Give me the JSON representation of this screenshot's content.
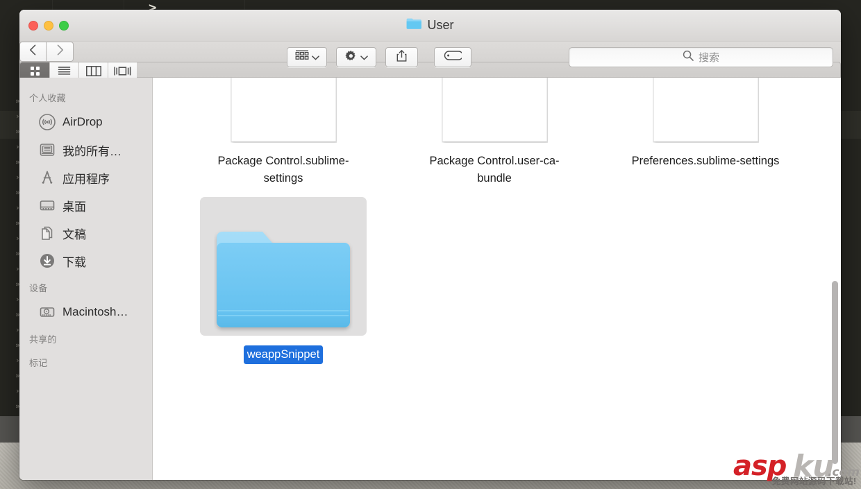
{
  "desktop": {
    "terminal_prompt": ">",
    "terminal_ticks": [
      "»",
      "›",
      "»",
      "›",
      "»",
      "›",
      "»",
      "›",
      "»",
      "›",
      "»",
      "›",
      "»",
      "›",
      "»",
      "›",
      "»",
      "›",
      "»",
      "›",
      "»",
      "›"
    ]
  },
  "window": {
    "title": "User",
    "title_icon": "folder-icon",
    "traffic_lights": [
      {
        "name": "close-button",
        "color": "#fc6058"
      },
      {
        "name": "minimize-button",
        "color": "#fec041"
      },
      {
        "name": "maximize-button",
        "color": "#3dcd47"
      }
    ]
  },
  "toolbar": {
    "back_icon": "chevron-left-icon",
    "forward_icon": "chevron-right-icon",
    "view_modes": [
      {
        "name": "icon-view",
        "icon": "grid-icon",
        "active": true
      },
      {
        "name": "list-view",
        "icon": "list-icon",
        "active": false
      },
      {
        "name": "column-view",
        "icon": "columns-icon",
        "active": false
      },
      {
        "name": "coverflow-view",
        "icon": "coverflow-icon",
        "active": false
      }
    ],
    "group_icon": "arrange-icon",
    "gear_icon": "gear-icon",
    "share_icon": "share-icon",
    "tag_icon": "tag-icon",
    "dropdown_icon": "chevron-down-icon"
  },
  "search": {
    "icon": "search-icon",
    "placeholder": "搜索",
    "value": ""
  },
  "sidebar": {
    "sections": [
      {
        "label": "个人收藏",
        "items": [
          {
            "label": "AirDrop",
            "icon": "airdrop-icon"
          },
          {
            "label": "我的所有…",
            "icon": "all-my-files-icon"
          },
          {
            "label": "应用程序",
            "icon": "applications-icon"
          },
          {
            "label": "桌面",
            "icon": "desktop-icon"
          },
          {
            "label": "文稿",
            "icon": "documents-icon"
          },
          {
            "label": "下载",
            "icon": "downloads-icon"
          }
        ]
      },
      {
        "label": "设备",
        "items": [
          {
            "label": "Macintosh…",
            "icon": "hard-drive-icon"
          }
        ]
      },
      {
        "label": "共享的",
        "items": []
      },
      {
        "label": "标记",
        "items": []
      }
    ]
  },
  "content": {
    "items": [
      {
        "name": "Package Control.sublime-settings",
        "type": "document",
        "selected": false
      },
      {
        "name": "Package Control.user-ca-bundle",
        "type": "document",
        "selected": false
      },
      {
        "name": "Preferences.sublime-settings",
        "type": "document",
        "selected": false
      },
      {
        "name": "weappSnippet",
        "type": "folder",
        "selected": true
      }
    ],
    "selection_color": "#1e6fdd"
  },
  "watermark": {
    "brand_red": "asp",
    "brand_gray": "ku",
    "domain": ".com",
    "subtitle": "免费网站源码下载站!"
  }
}
